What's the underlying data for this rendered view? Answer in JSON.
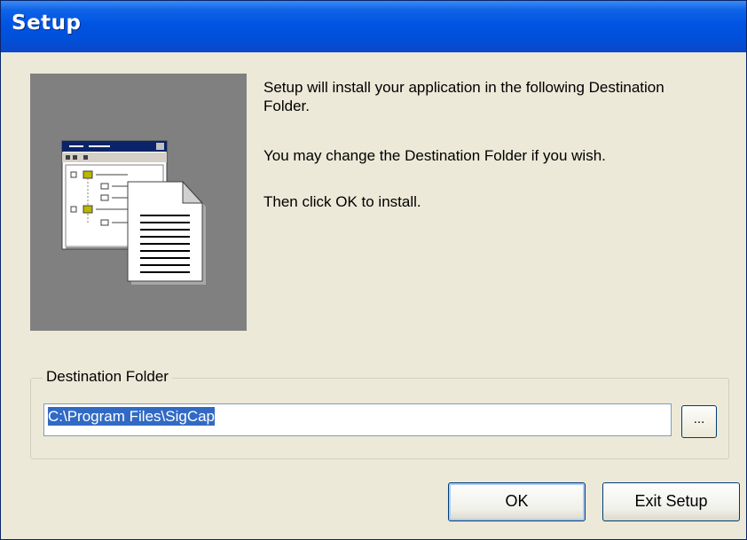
{
  "window": {
    "title": "Setup"
  },
  "illustration": {
    "name": "setup-illustration"
  },
  "message": {
    "line1": "Setup will install your application in the following Destination Folder.",
    "line2": "You may change the Destination Folder if you wish.",
    "line3": "Then click OK to install."
  },
  "destination": {
    "group_label": "Destination Folder",
    "path": "C:\\Program Files\\SigCap",
    "browse_label": "..."
  },
  "buttons": {
    "ok": "OK",
    "exit": "Exit Setup"
  },
  "colors": {
    "titlebar": "#0054e3",
    "dialog_bg": "#ece9d8",
    "selection": "#316ac5"
  }
}
